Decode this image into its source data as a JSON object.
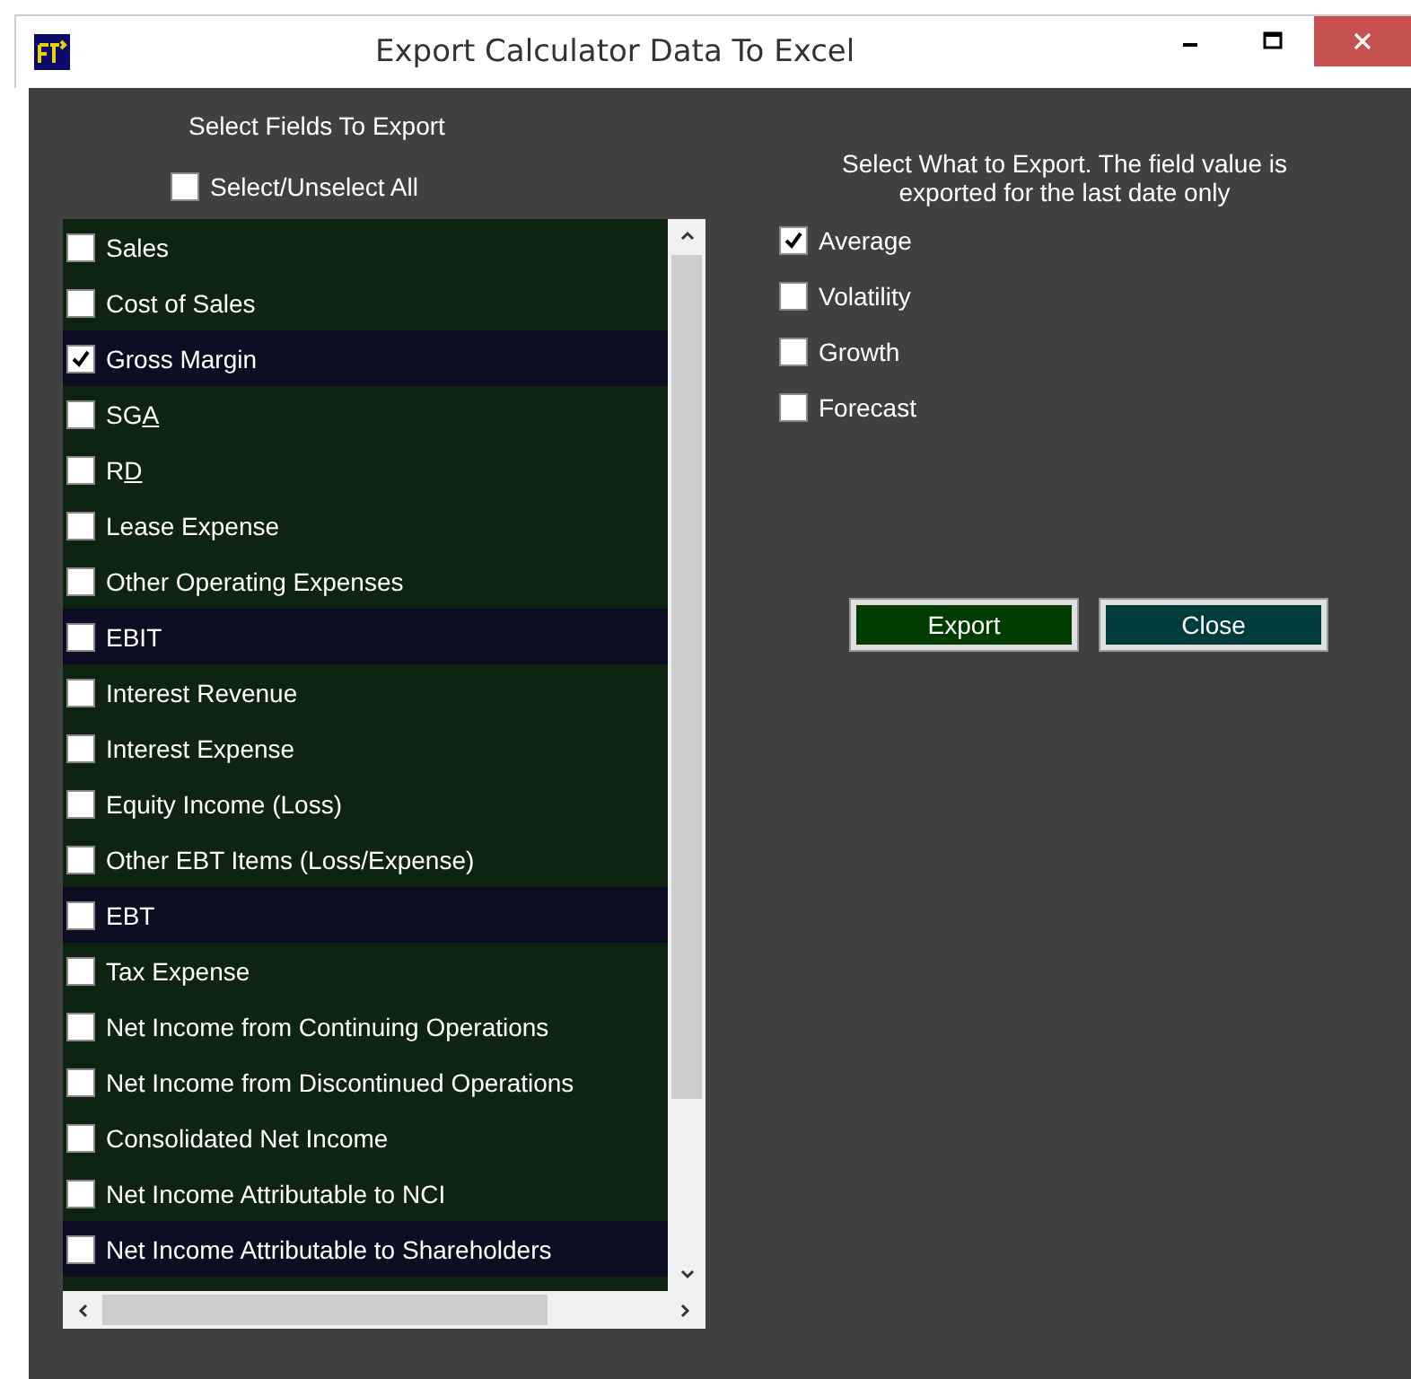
{
  "window": {
    "title": "Export Calculator Data To Excel"
  },
  "fields_heading": "Select Fields To Export",
  "select_all": {
    "label": "Select/Unselect All",
    "checked": false
  },
  "fields": [
    {
      "label": "Sales",
      "checked": false,
      "highlighted": false
    },
    {
      "label": "Cost of Sales",
      "checked": false,
      "highlighted": false
    },
    {
      "label": "Gross Margin",
      "checked": true,
      "highlighted": true
    },
    {
      "label": "SG",
      "underlined": "A",
      "checked": false,
      "highlighted": false
    },
    {
      "label": "R",
      "underlined": "D",
      "checked": false,
      "highlighted": false
    },
    {
      "label": "Lease Expense",
      "checked": false,
      "highlighted": false
    },
    {
      "label": "Other Operating Expenses",
      "checked": false,
      "highlighted": false
    },
    {
      "label": "EBIT",
      "checked": false,
      "highlighted": true
    },
    {
      "label": "Interest Revenue",
      "checked": false,
      "highlighted": false
    },
    {
      "label": "Interest Expense",
      "checked": false,
      "highlighted": false
    },
    {
      "label": "Equity Income (Loss)",
      "checked": false,
      "highlighted": false
    },
    {
      "label": "Other EBT Items (Loss/Expense)",
      "checked": false,
      "highlighted": false
    },
    {
      "label": "EBT",
      "checked": false,
      "highlighted": true
    },
    {
      "label": "Tax Expense",
      "checked": false,
      "highlighted": false
    },
    {
      "label": "Net Income from Continuing Operations",
      "checked": false,
      "highlighted": false
    },
    {
      "label": "Net Income from Discontinued Operations",
      "checked": false,
      "highlighted": false
    },
    {
      "label": "Consolidated Net Income",
      "checked": false,
      "highlighted": false
    },
    {
      "label": "Net Income Attributable to NCI",
      "checked": false,
      "highlighted": false
    },
    {
      "label": "Net Income Attributable to Shareholders",
      "checked": false,
      "highlighted": true
    }
  ],
  "export_heading": "Select What to Export.  The field value is exported for the last date only",
  "options": [
    {
      "label": "Average",
      "checked": true
    },
    {
      "label": "Volatility",
      "checked": false
    },
    {
      "label": "Growth",
      "checked": false
    },
    {
      "label": "Forecast",
      "checked": false
    }
  ],
  "buttons": [
    {
      "label": "Export",
      "kind": "export"
    },
    {
      "label": "Close",
      "kind": "close"
    }
  ]
}
